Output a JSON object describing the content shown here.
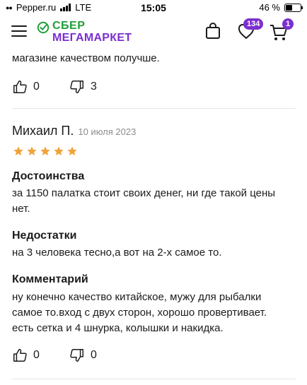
{
  "status_bar": {
    "carrier": "Pepper.ru",
    "network": "LTE",
    "time": "15:05",
    "battery": "46 %"
  },
  "header": {
    "logo_top": "СБЕР",
    "logo_bottom": "МЕГАМАРКЕТ",
    "favorites_count": "134",
    "cart_count": "1",
    "brand_color": "#7b2fd0",
    "logo_green": "#21a038"
  },
  "previous_review": {
    "tail_text": "магазине качеством получше.",
    "likes": "0",
    "dislikes": "3"
  },
  "review": {
    "author": "Михаил П.",
    "date": "10 июля 2023",
    "rating": 5,
    "star_color": "#f0a33a",
    "pros_title": "Достоинства",
    "pros_lines": [
      "за 1150 палатка стоит своих денег, ни где такой цены",
      "нет."
    ],
    "cons_title": "Недостатки",
    "cons_lines": [
      "на 3 человека тесно,а вот на 2-х самое то."
    ],
    "comment_title": "Комментарий",
    "comment_lines": [
      "ну конечно качество китайское, мужу для рыбалки",
      "самое то.вход с двух сторон, хорошо провертивает.",
      "есть сетка и 4 шнурка, колышки и накидка."
    ],
    "likes": "0",
    "dislikes": "0"
  }
}
